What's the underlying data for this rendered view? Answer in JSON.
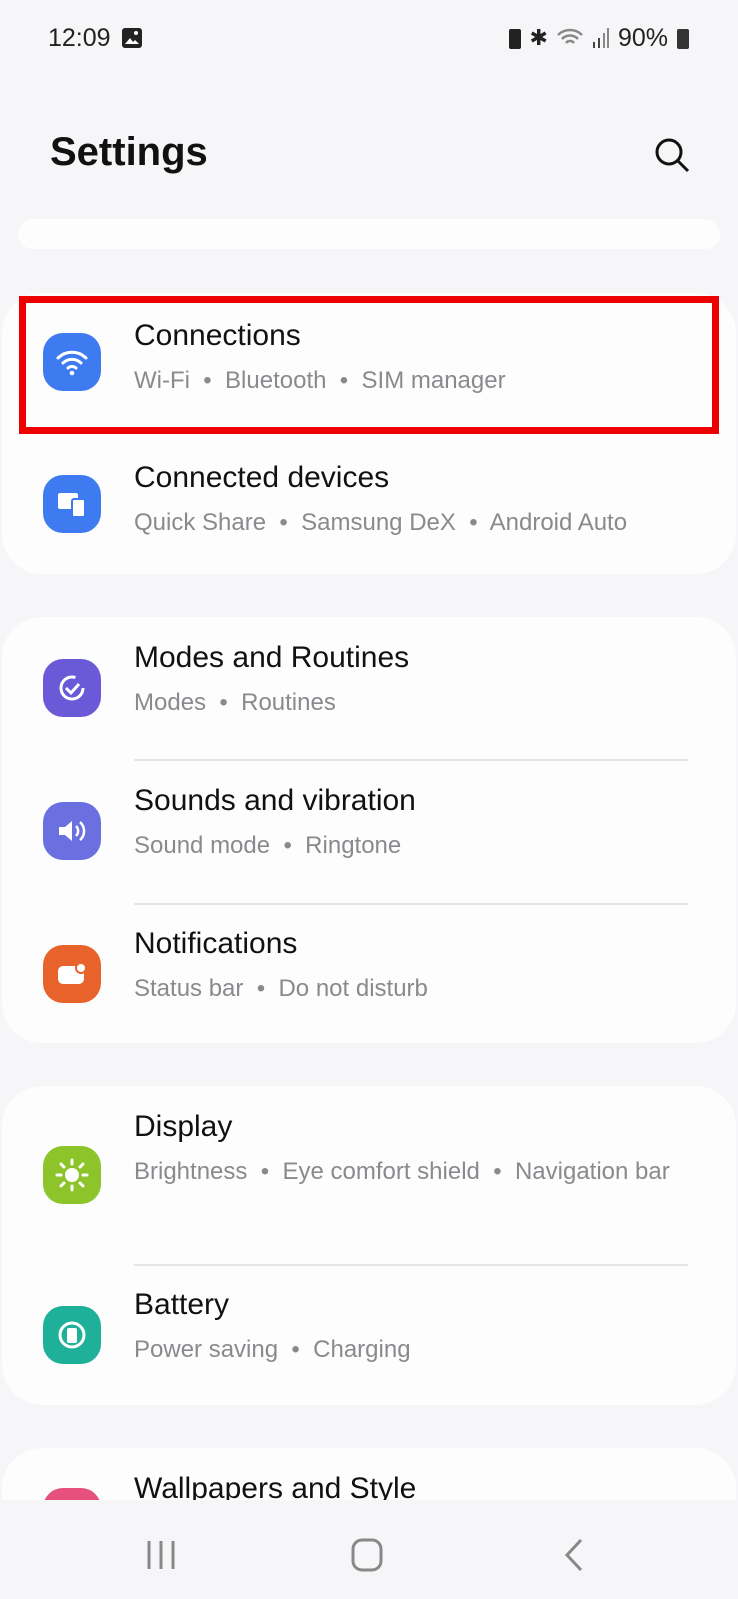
{
  "status_bar": {
    "time": "12:09",
    "battery": "90%",
    "icons": [
      "gallery-icon",
      "battery-saver-icon",
      "bluetooth-icon",
      "wifi-icon",
      "signal-icon",
      "battery-icon"
    ]
  },
  "header": {
    "title": "Settings",
    "search_icon": "search-icon"
  },
  "highlight_color": "#ee0000",
  "groups": [
    {
      "items": [
        {
          "title": "Connections",
          "subtitle": "Wi-Fi  •  Bluetooth  •  SIM manager",
          "icon": "wifi-icon",
          "color": "#3e7bf0"
        },
        {
          "title": "Connected devices",
          "subtitle": "Quick Share  •  Samsung DeX  •  Android Auto",
          "icon": "devices-icon",
          "color": "#3e7bf0"
        }
      ]
    },
    {
      "items": [
        {
          "title": "Modes and Routines",
          "subtitle": "Modes  •  Routines",
          "icon": "routines-icon",
          "color": "#6a5ad8"
        },
        {
          "title": "Sounds and vibration",
          "subtitle": "Sound mode  •  Ringtone",
          "icon": "speaker-icon",
          "color": "#6a70e0"
        },
        {
          "title": "Notifications",
          "subtitle": "Status bar  •  Do not disturb",
          "icon": "notification-icon",
          "color": "#e8622c"
        }
      ]
    },
    {
      "items": [
        {
          "title": "Display",
          "subtitle": "Brightness  •  Eye comfort shield  •  Navigation bar",
          "icon": "sun-icon",
          "color": "#8cc42a"
        },
        {
          "title": "Battery",
          "subtitle": "Power saving  •  Charging",
          "icon": "battery-icon",
          "color": "#1fb09a"
        }
      ]
    },
    {
      "items": [
        {
          "title": "Wallpapers and Style",
          "icon": "wallpaper-icon",
          "color": "#e5507c"
        }
      ]
    }
  ]
}
